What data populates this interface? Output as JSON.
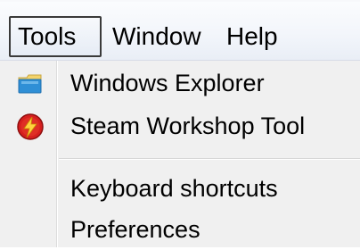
{
  "menubar": {
    "items": [
      {
        "label": "Tools",
        "active": true
      },
      {
        "label": "Window",
        "active": false
      },
      {
        "label": "Help",
        "active": false
      }
    ]
  },
  "tools_menu": {
    "items": [
      {
        "label": "Windows Explorer",
        "icon": "folder-icon"
      },
      {
        "label": "Steam Workshop Tool",
        "icon": "workshop-tool-icon"
      },
      {
        "label": "Keyboard shortcuts",
        "icon": null
      },
      {
        "label": "Preferences",
        "icon": null
      }
    ]
  },
  "colors": {
    "active_border": "#3a3a3a",
    "menu_background": "#f0f0f0",
    "folder_blue": "#2f8fd6",
    "folder_yellow": "#f3d36b",
    "workshop_red": "#d61f1f",
    "workshop_bolt": "#ffd23f"
  }
}
